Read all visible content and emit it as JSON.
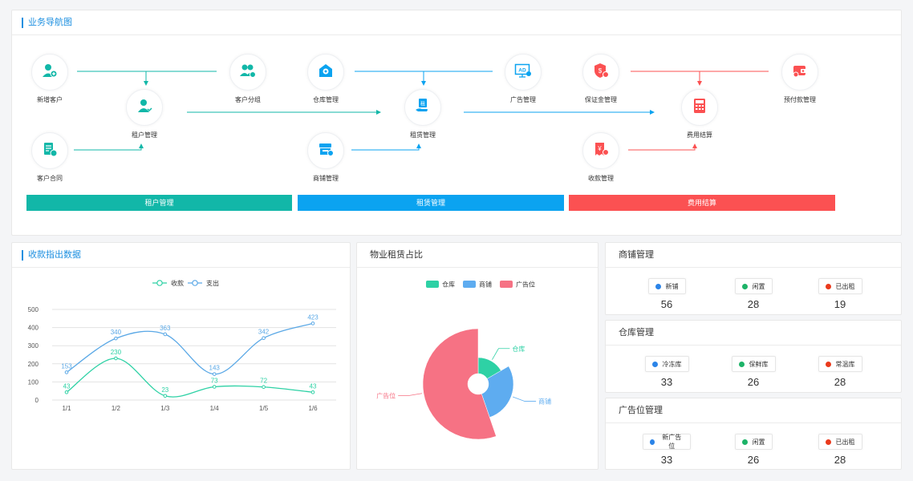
{
  "nav": {
    "title": "业务导航图",
    "nodes": {
      "add_customer": "新增客户",
      "tenant_mgmt": "租户管理",
      "customer_contract": "客户合同",
      "customer_group": "客户分组",
      "warehouse_mgmt": "仓库管理",
      "shop_mgmt": "商铺管理",
      "lease_mgmt": "租赁管理",
      "ad_mgmt": "广告管理",
      "deposit_mgmt": "保证金管理",
      "collection_mgmt": "收款管理",
      "fee_settlement": "费用结算",
      "prepay_mgmt": "预付款管理"
    },
    "bands": [
      "租户管理",
      "租赁管理",
      "费用结算"
    ],
    "colors": {
      "teal": "#12b7a8",
      "blue": "#0ba3f0",
      "red": "#fb5152"
    }
  },
  "income_chart": {
    "title": "收款指出数据",
    "chart_data": {
      "type": "line",
      "categories": [
        "1/1",
        "1/2",
        "1/3",
        "1/4",
        "1/5",
        "1/6"
      ],
      "ylim": [
        0,
        500
      ],
      "yticks": [
        "500",
        "400",
        "300",
        "200",
        "100",
        "0"
      ],
      "series": [
        {
          "name": "收款",
          "color": "#2ed1a5",
          "values": [
            43,
            230,
            23,
            73,
            72,
            43
          ]
        },
        {
          "name": "支出",
          "color": "#5aa8e6",
          "values": [
            153,
            340,
            363,
            143,
            342,
            423
          ]
        }
      ]
    }
  },
  "rent_chart": {
    "title": "物业租赁占比",
    "chart_data": {
      "type": "pie",
      "rose": true,
      "slices": [
        {
          "name": "仓库",
          "value": 33,
          "color": "#2ed1a5"
        },
        {
          "name": "商铺",
          "value": 56,
          "color": "#5eacf0"
        },
        {
          "name": "广告位",
          "value": 110,
          "color": "#f67284"
        }
      ]
    }
  },
  "shop_panel": {
    "title": "商铺管理",
    "items": [
      {
        "label": "新铺",
        "value": "56",
        "color": "#2b84e8"
      },
      {
        "label": "闲置",
        "value": "28",
        "color": "#1db368"
      },
      {
        "label": "已出租",
        "value": "19",
        "color": "#ea3a1c"
      }
    ]
  },
  "warehouse_panel": {
    "title": "仓库管理",
    "items": [
      {
        "label": "冷冻库",
        "value": "33",
        "color": "#2b84e8"
      },
      {
        "label": "保鲜库",
        "value": "26",
        "color": "#1db368"
      },
      {
        "label": "常温库",
        "value": "28",
        "color": "#ea3a1c"
      }
    ]
  },
  "ad_panel": {
    "title": "广告位管理",
    "items": [
      {
        "label": "新广告位",
        "value": "33",
        "color": "#2b84e8"
      },
      {
        "label": "闲置",
        "value": "26",
        "color": "#1db368"
      },
      {
        "label": "已出租",
        "value": "28",
        "color": "#ea3a1c"
      }
    ]
  }
}
